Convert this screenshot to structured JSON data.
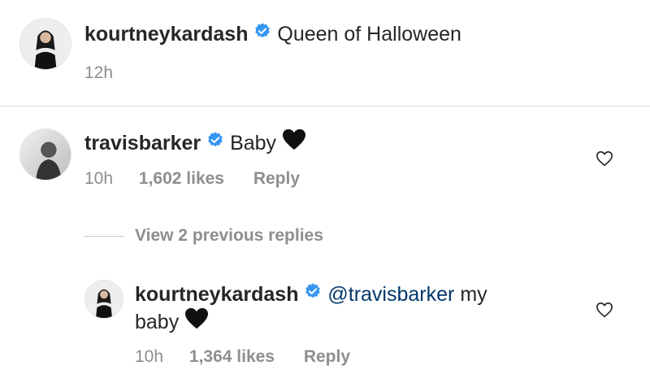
{
  "caption": {
    "username": "kourtneykardash",
    "text": "Queen of Halloween",
    "time": "12h"
  },
  "comment": {
    "username": "travisbarker",
    "text": "Baby",
    "time": "10h",
    "likes": "1,602 likes",
    "reply_label": "Reply"
  },
  "view_replies": "View 2 previous replies",
  "reply": {
    "username": "kourtneykardash",
    "mention": "@travisbarker",
    "text_line1": "my",
    "text_line2": "baby",
    "time": "10h",
    "likes": "1,364 likes",
    "reply_label": "Reply"
  },
  "colors": {
    "verified": "#3897f0",
    "meta": "#8e8e8e",
    "mention": "#00376b"
  },
  "icons": [
    "verified-icon",
    "heart-outline-icon",
    "black-heart-emoji"
  ]
}
